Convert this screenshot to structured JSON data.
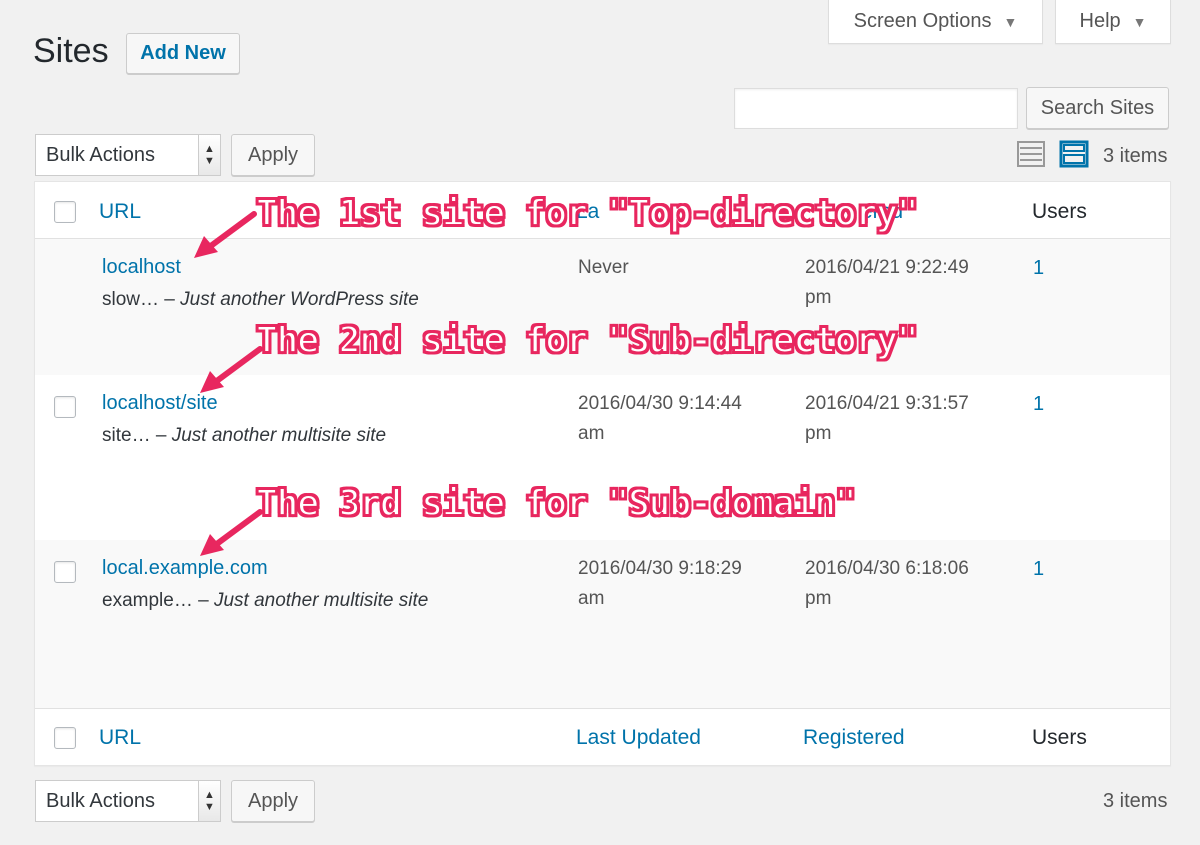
{
  "screen_meta": {
    "screen_options": "Screen Options",
    "help": "Help",
    "arrow": "▼"
  },
  "header": {
    "title": "Sites",
    "add_new": "Add New"
  },
  "search": {
    "placeholder": "",
    "button": "Search Sites"
  },
  "tablenav_top": {
    "bulk_actions": "Bulk Actions",
    "apply": "Apply",
    "count": "3 items",
    "views": [
      "list-view-icon",
      "excerpt-view-icon"
    ]
  },
  "table": {
    "columns": {
      "url": "URL",
      "last_updated": "Last Updated",
      "registered": "Registered",
      "users": "Users"
    },
    "header_top": {
      "last_updated_visible": "La",
      "registered_visible": "ered"
    },
    "rows": [
      {
        "url": "localhost",
        "name": "slow…",
        "sep": " – ",
        "tagline": "Just another WordPress site",
        "last_updated_1": "Never",
        "last_updated_2": "",
        "registered_1": "2016/04/21 9:22:49",
        "registered_2": "pm",
        "users": "1"
      },
      {
        "url": "localhost/site",
        "name": "site…",
        "sep": " – ",
        "tagline": "Just another multisite site",
        "last_updated_1": "2016/04/30 9:14:44",
        "last_updated_2": "am",
        "registered_1": "2016/04/21 9:31:57",
        "registered_2": "pm",
        "users": "1"
      },
      {
        "url": "local.example.com",
        "name": "example…",
        "sep": " – ",
        "tagline": "Just another multisite site",
        "last_updated_1": "2016/04/30 9:18:29",
        "last_updated_2": "am",
        "registered_1": "2016/04/30 6:18:06",
        "registered_2": "pm",
        "users": "1"
      }
    ]
  },
  "tablenav_bottom": {
    "bulk_actions": "Bulk Actions",
    "apply": "Apply",
    "count": "3 items"
  },
  "annotations": {
    "a1": "The 1st site for \"Top-directory\"",
    "a2": "The 2nd site for \"Sub-directory\"",
    "a3": "The 3rd site for \"Sub-domain\""
  },
  "colors": {
    "link": "#0073aa",
    "annotation": "#e8275f",
    "background": "#f1f1f1"
  }
}
